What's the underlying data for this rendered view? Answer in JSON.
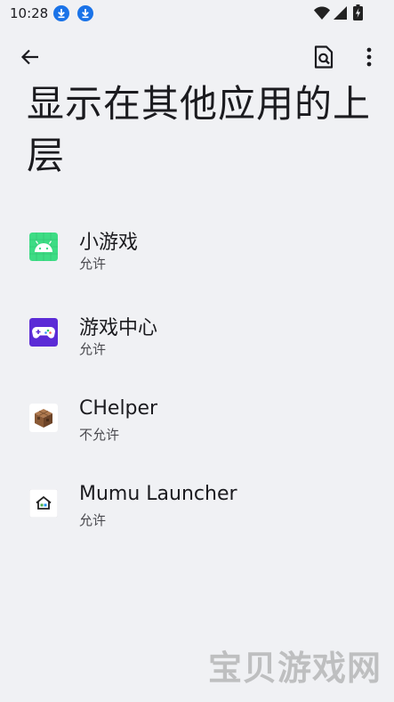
{
  "status_bar": {
    "time": "10:28"
  },
  "header": {
    "title": "显示在其他应用的上层"
  },
  "apps": [
    {
      "name": "小游戏",
      "status": "允许",
      "icon": "android-icon"
    },
    {
      "name": "游戏中心",
      "status": "允许",
      "icon": "gamepad-icon"
    },
    {
      "name": "CHelper",
      "status": "不允许",
      "icon": "crafting-table-icon"
    },
    {
      "name": "Mumu Launcher",
      "status": "允许",
      "icon": "house-icon"
    }
  ],
  "watermark": "宝贝游戏网",
  "colors": {
    "background": "#f0f1f4",
    "android_green": "#3ddc84",
    "gamepad_purple": "#5b2bd6",
    "text_primary": "#1b1b1f",
    "text_secondary": "#4a4a4f"
  }
}
